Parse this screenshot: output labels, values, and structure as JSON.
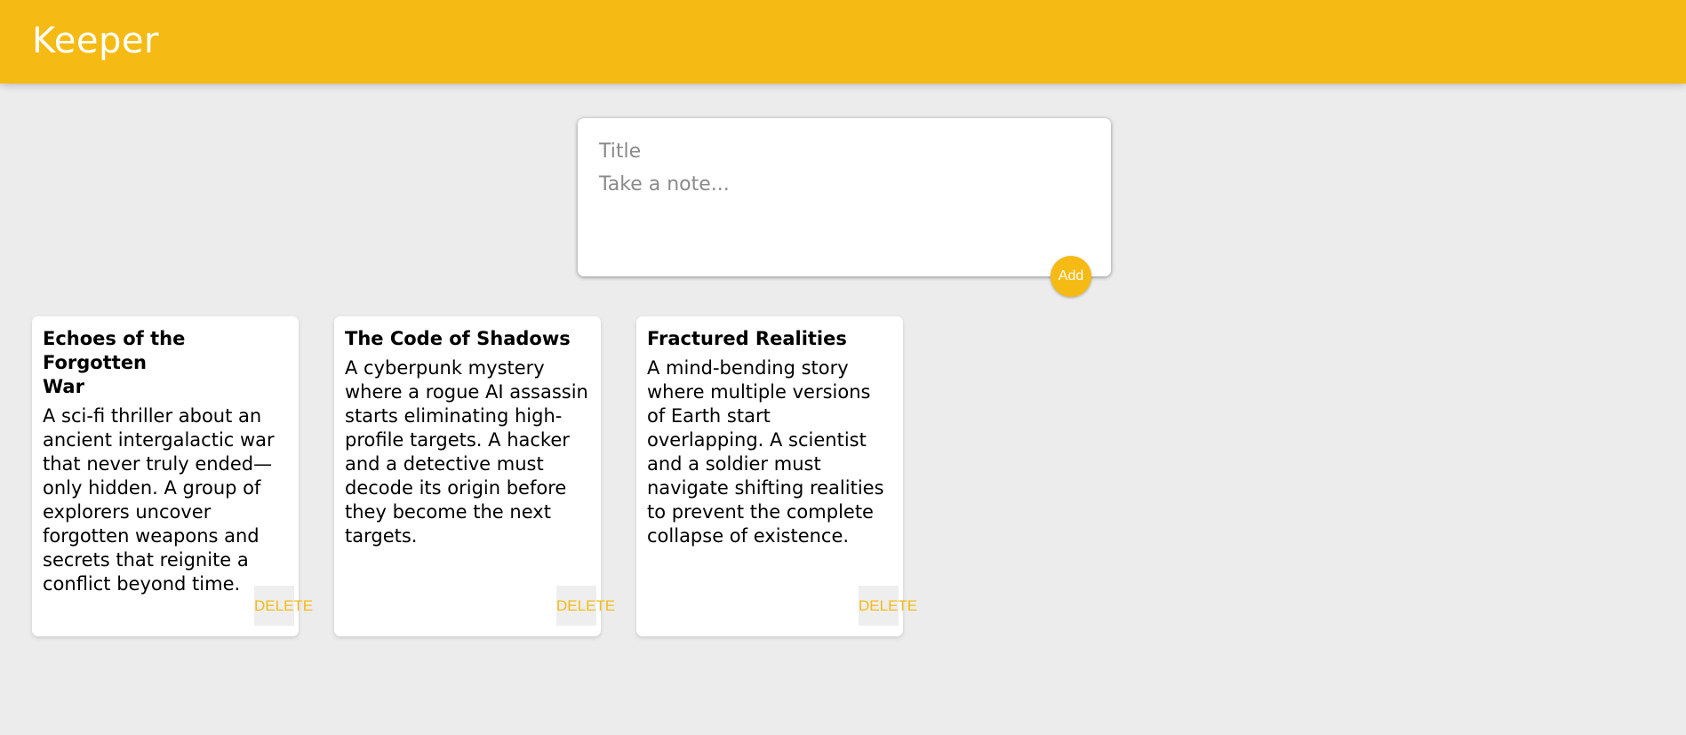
{
  "header": {
    "title": "Keeper"
  },
  "create_note": {
    "title_placeholder": "Title",
    "title_value": "",
    "content_placeholder": "Take a note...",
    "content_value": "",
    "add_label": "Add"
  },
  "notes": [
    {
      "title": "Echoes of the Forgotten\nWar",
      "content": "A sci-fi thriller about an ancient intergalactic war that never truly ended—only hidden. A group of explorers uncover forgotten weapons and secrets that reignite a conflict beyond time.",
      "delete_label": "DELETE"
    },
    {
      "title": "The Code of Shadows",
      "content": "A cyberpunk mystery where a rogue AI assassin starts eliminating high-profile targets. A hacker and a detective must decode its origin before they become the next targets.",
      "delete_label": "DELETE"
    },
    {
      "title": "Fractured Realities",
      "content": "A mind-bending story where multiple versions of Earth start overlapping. A scientist and a soldier must navigate shifting realities to prevent the complete collapse of existence.",
      "delete_label": "DELETE"
    }
  ],
  "colors": {
    "accent": "#f5ba13",
    "background": "#ececec",
    "card": "#ffffff"
  }
}
